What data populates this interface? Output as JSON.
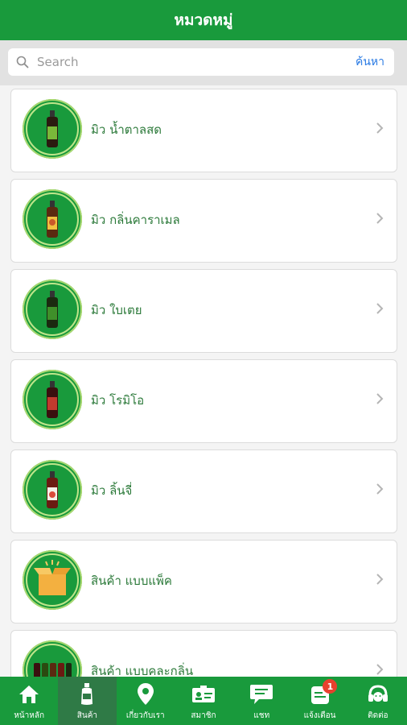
{
  "header": {
    "title": "หมวดหมู่"
  },
  "search": {
    "placeholder": "Search",
    "button_label": "ค้นหา"
  },
  "categories": [
    {
      "label": "มิว น้ำตาลสด",
      "icon": "bottle-icon",
      "color": "#4c8a2a"
    },
    {
      "label": "มิว กลิ่นคาราเมล",
      "icon": "bottle-icon",
      "color": "#c9582a"
    },
    {
      "label": "มิว ใบเตย",
      "icon": "bottle-icon",
      "color": "#2f6b2a"
    },
    {
      "label": "มิว โรมิโอ",
      "icon": "bottle-icon",
      "color": "#b1302b"
    },
    {
      "label": "มิว ลิ้นจี่",
      "icon": "bottle-icon",
      "color": "#d94a3a"
    },
    {
      "label": "สินค้า แบบแพ็ค",
      "icon": "box-icon",
      "color": "#f3b040"
    },
    {
      "label": "สินค้า แบบคละกลิ่น",
      "icon": "bottles-icon",
      "color": "#8a2a2a"
    }
  ],
  "tabs": [
    {
      "label": "หน้าหลัก",
      "icon": "home-icon"
    },
    {
      "label": "สินค้า",
      "icon": "bottle-icon",
      "active": true
    },
    {
      "label": "เกี่ยวกับเรา",
      "icon": "location-pin-icon"
    },
    {
      "label": "สมาชิก",
      "icon": "member-card-icon"
    },
    {
      "label": "แชท",
      "icon": "chat-icon"
    },
    {
      "label": "แจ้งเตือน",
      "icon": "notification-icon",
      "badge": "1"
    },
    {
      "label": "ติดต่อ",
      "icon": "headset-icon"
    }
  ],
  "colors": {
    "primary": "#199a3c",
    "active_tab": "#2f7a46",
    "badge": "#e8412e",
    "link": "#2a7be4"
  }
}
